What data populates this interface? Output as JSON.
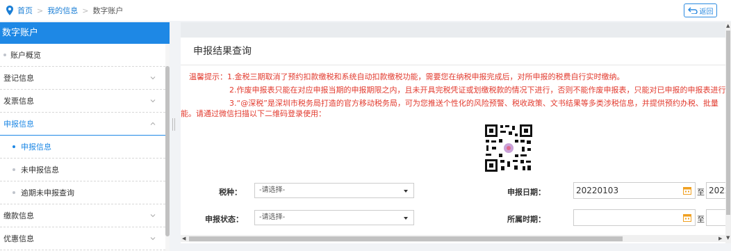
{
  "breadcrumb": {
    "home": "首页",
    "mid": "我的信息",
    "current": "数字账户"
  },
  "back_button": {
    "label": "返回"
  },
  "sidebar": {
    "title": "数字账户",
    "items": [
      {
        "label": "账户概览"
      },
      {
        "label": "登记信息"
      },
      {
        "label": "发票信息"
      },
      {
        "label": "申报信息"
      },
      {
        "label": "申报信息"
      },
      {
        "label": "未申报信息"
      },
      {
        "label": "逾期未申报查询"
      },
      {
        "label": "缴款信息"
      },
      {
        "label": "优惠信息"
      }
    ]
  },
  "panel": {
    "title": "申报结果查询"
  },
  "notice": {
    "line1": "温馨提示：1.金税三期取消了预约扣款缴税和系统自动扣款缴税功能，需要您在纳税申报完成后，对所申报的税费自行实时缴纳。",
    "line2": "2.作废申报表只能在对应申报当期的申报期限之内，且未开具完税凭证或划缴税款的情况下进行，否则不能作废申报表，只能对已申报的申报表进行",
    "line3": "3.“@深税”是深圳市税务局打造的官方移动税务局，可为您推送个性化的风险预警、税收政策、文书结果等多类涉税信息，并提供预约办税、批量",
    "line4": "能。请通过微信扫描以下二维码登录使用："
  },
  "form": {
    "tax_type_label": "税种：",
    "tax_type_value": "-请选择-",
    "status_label": "申报状态：",
    "status_value": "-请选择-",
    "date_label": "申报日期：",
    "date_from": "20220103",
    "date_to_partial": "2022",
    "period_label": "所属时期：",
    "to_label": "至"
  },
  "colors": {
    "accent": "#1e88e5",
    "notice": "#e23a2e",
    "calendar": "#f0a020"
  }
}
